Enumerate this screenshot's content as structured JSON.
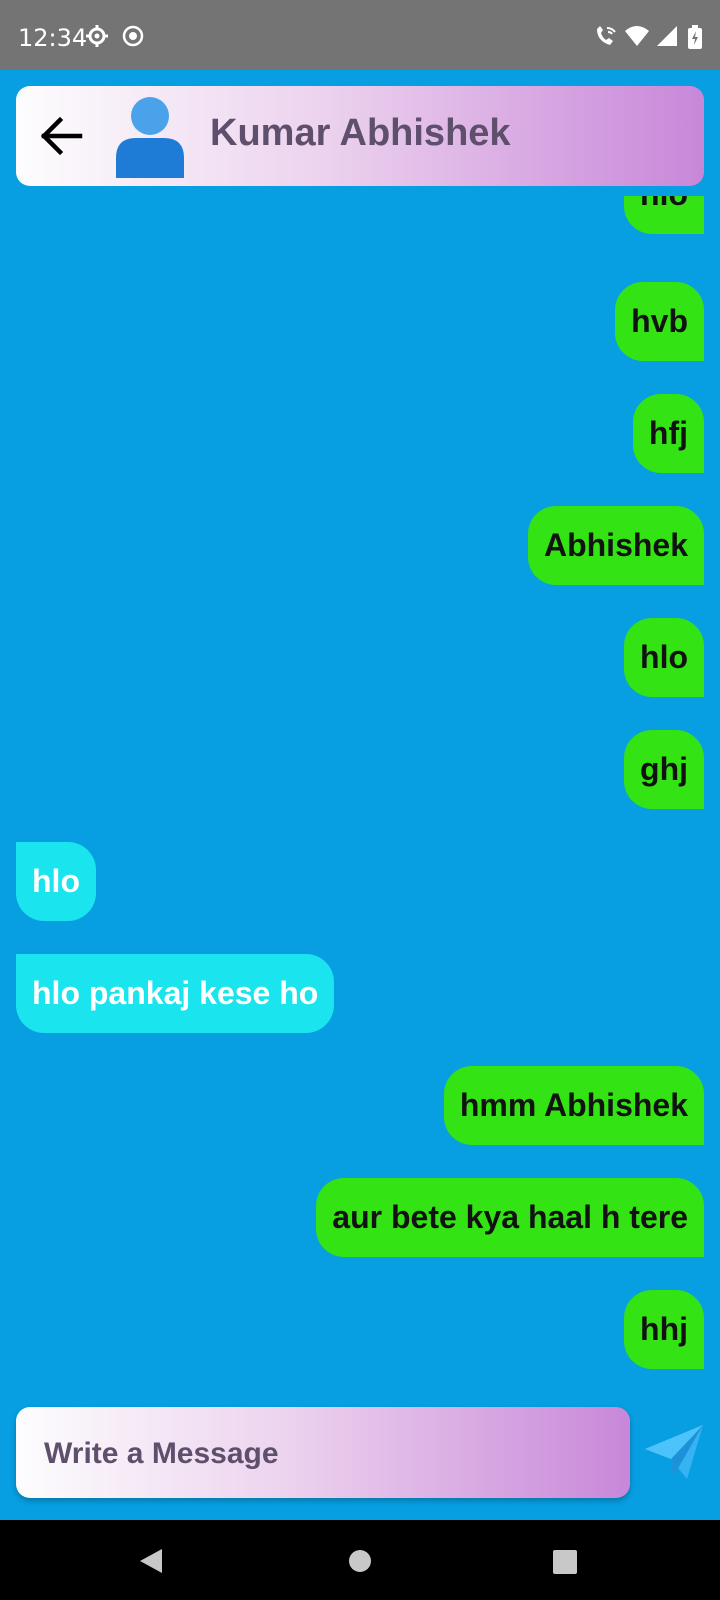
{
  "status_bar": {
    "time": "12:34",
    "icons": [
      "settings-icon",
      "location-record-icon",
      "wifi-call-icon",
      "wifi-icon",
      "signal-icon",
      "battery-icon"
    ]
  },
  "header": {
    "contact_name": "Kumar Abhishek",
    "back_icon": "back-arrow-icon",
    "avatar_icon": "person-icon"
  },
  "messages": [
    {
      "text": "hlo",
      "direction": "sent"
    },
    {
      "text": "hvb",
      "direction": "sent"
    },
    {
      "text": "hfj",
      "direction": "sent"
    },
    {
      "text": "Abhishek",
      "direction": "sent"
    },
    {
      "text": "hlo",
      "direction": "sent"
    },
    {
      "text": "ghj",
      "direction": "sent"
    },
    {
      "text": "hlo",
      "direction": "received"
    },
    {
      "text": "hlo pankaj kese ho",
      "direction": "received"
    },
    {
      "text": "hmm Abhishek",
      "direction": "sent"
    },
    {
      "text": "aur bete kya haal h tere",
      "direction": "sent"
    },
    {
      "text": "hhj",
      "direction": "sent"
    }
  ],
  "composer": {
    "placeholder": "Write a Message",
    "value": "",
    "send_icon": "send-icon"
  },
  "nav_bar": {
    "icons": [
      "back-triangle-icon",
      "home-circle-icon",
      "recents-square-icon"
    ]
  },
  "colors": {
    "background": "#079fe1",
    "sent_bubble": "#33e313",
    "received_bubble": "#1ae4ee",
    "header_gradient_end": "#c887d9",
    "name_text": "#5e4f6c"
  }
}
